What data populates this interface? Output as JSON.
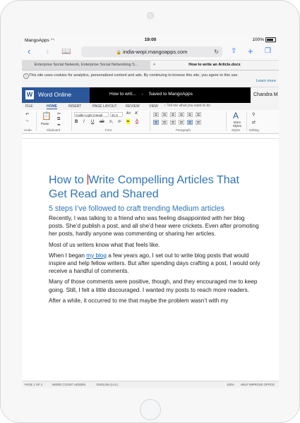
{
  "status_bar": {
    "carrier": "MangoApps",
    "time": "19:00",
    "battery": "100%"
  },
  "safari": {
    "url": "india-wopi.mangoapps.com"
  },
  "tabs": [
    {
      "label": "Enterprise Social Network, Enterprise Social Networking S..."
    },
    {
      "label": "How to write an Article.docx"
    }
  ],
  "cookie_banner": {
    "text": "This site uses cookies for analytics, personalized content and ads. By continuing to browse this site, you agree to this use.",
    "learn_more": "Learn more"
  },
  "word_header": {
    "app_name": "Word Online",
    "doc_title": "How to writ...",
    "separator": "-",
    "save_status": "Saved to MangoApps",
    "user": "Chandra M"
  },
  "ribbon_tabs": [
    "FILE",
    "HOME",
    "INSERT",
    "PAGE LAYOUT",
    "REVIEW",
    "VIEW"
  ],
  "tell_me": "Tell me what you want to do",
  "ribbon": {
    "paste": "Paste",
    "font_name": "Calibri Light (Headi",
    "font_size": "31.5",
    "more_styles": "More Styles",
    "groups": {
      "undo": "Undo",
      "clipboard": "Clipboard",
      "font": "Font",
      "paragraph": "Paragraph",
      "styles": "Styles",
      "editing": "Editing"
    }
  },
  "document": {
    "title_before_cursor": "How to ",
    "title_after_cursor": "Write Compelling Articles That Get Read and Shared",
    "subtitle": "5 steps I’ve followed to craft trending Medium articles",
    "p1": "Recently, I was talking to a friend who was feeling disappointed with her blog posts. She’d publish a post, and all she’d hear were crickets. Even after promoting her posts, hardly anyone was commenting or sharing her articles.",
    "p2": "Most of us writers know what that feels like.",
    "p3_a": "When I began ",
    "p3_link": "my blog",
    "p3_b": " a few years ago, I set out to write blog posts that would inspire and help fellow writers. But after spending days crafting a post, I would only receive a handful of comments.",
    "p4": "Many of those comments were positive, though, and they encouraged me to keep going. Still, I felt a little discouraged. I wanted my posts to reach more readers.",
    "p5": "After a while, it occurred to me that maybe the problem wasn’t with my"
  },
  "doc_status": {
    "page": "PAGE 1 OF 2",
    "word_count": "WORD COUNT: HIDDEN",
    "language": "ENGLISH (U.S.)",
    "zoom": "100%",
    "help": "HELP IMPROVE OFFICE"
  }
}
